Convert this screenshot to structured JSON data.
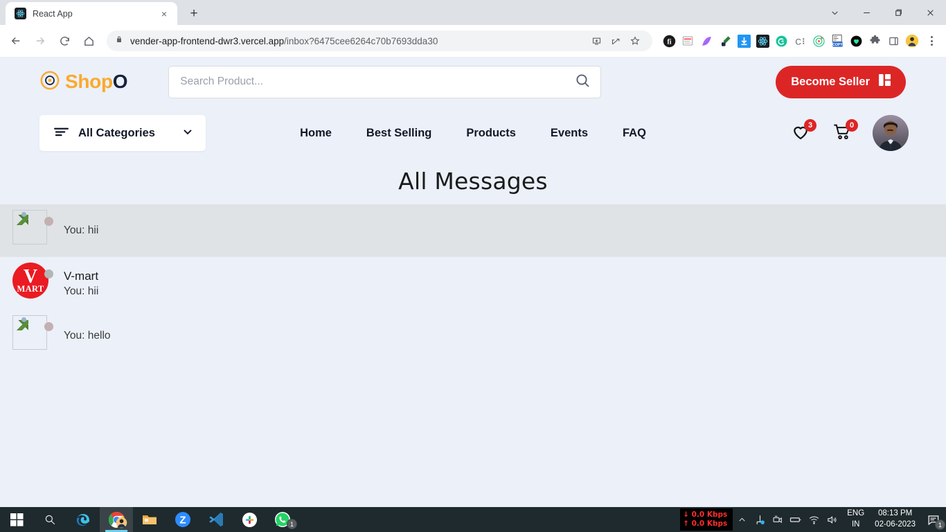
{
  "browser": {
    "tab": {
      "title": "React App",
      "favicon": "react-icon",
      "close_label": "×"
    },
    "new_tab_label": "+",
    "window_controls": {
      "tab_search": "tab-search-icon",
      "minimize": "minimize-icon",
      "maximize": "maximize-icon",
      "close": "close-icon"
    },
    "url": "vender-app-frontend-dwr3.vercel.app",
    "url_path": "/inbox?6475cee6264c70b7693dda30",
    "extensions": [
      "install-icon",
      "share-icon",
      "bookmark-star-icon",
      "bitwarden-icon",
      "notes-icon",
      "gradient-icon",
      "eyedropper-icon",
      "download-icon",
      "react-devtools-icon",
      "grammarly-icon",
      "clickup-icon",
      "target-icon",
      "copy-icon",
      "heart-green-icon",
      "puzzle-icon",
      "sidepanel-icon",
      "profile-avatar-icon",
      "chrome-menu-icon"
    ]
  },
  "shop": {
    "logo": {
      "shop_text": "Shop",
      "o_text": "O",
      "icon": "target-logo-icon",
      "shop_color": "#fba92c",
      "o_color": "#17223b"
    },
    "search": {
      "placeholder": "Search Product...",
      "value": "",
      "icon": "search-icon"
    },
    "seller_button": {
      "label": "Become Seller",
      "icon": "dashboard-icon",
      "color": "#dc2626"
    },
    "categories": {
      "label": "All Categories",
      "icon": "filter-lines-icon",
      "chevron": "chevron-down-icon"
    },
    "nav_links": [
      "Home",
      "Best Selling",
      "Products",
      "Events",
      "FAQ"
    ],
    "actions": {
      "wishlist": {
        "icon": "heart-icon",
        "count": "3"
      },
      "cart": {
        "icon": "cart-icon",
        "count": "0"
      },
      "avatar": {
        "icon": "user-avatar"
      }
    }
  },
  "main": {
    "title": "All Messages",
    "conversations": [
      {
        "name": "",
        "preview": "You: hii",
        "avatar_type": "broken-image",
        "status": "away",
        "selected": true
      },
      {
        "name": "V-mart",
        "preview": "You: hii",
        "avatar_type": "vmart",
        "vmart_v": "V",
        "vmart_mart": "MART",
        "status": "offline",
        "selected": false
      },
      {
        "name": "",
        "preview": "You: hello",
        "avatar_type": "broken-image",
        "status": "away",
        "selected": false
      }
    ]
  },
  "taskbar": {
    "items": [
      {
        "name": "start-button",
        "icon": "windows-icon"
      },
      {
        "name": "search-button",
        "icon": "search-icon"
      },
      {
        "name": "edge",
        "icon": "edge-icon"
      },
      {
        "name": "chrome",
        "icon": "chrome-icon",
        "active": true
      },
      {
        "name": "file-explorer",
        "icon": "folder-icon"
      },
      {
        "name": "zoom",
        "icon": "zoom-icon"
      },
      {
        "name": "vscode",
        "icon": "vscode-icon"
      },
      {
        "name": "slack",
        "icon": "slack-icon"
      },
      {
        "name": "whatsapp",
        "icon": "whatsapp-icon",
        "badge": "1"
      }
    ],
    "network": {
      "download": "0.0 Kbps",
      "upload": "0.0 Kbps",
      "down_arrow": "↓",
      "up_arrow": "↑"
    },
    "tray_icons": [
      "chevron-up-icon",
      "network-share-icon",
      "camera-icon",
      "battery-icon",
      "wifi-icon",
      "volume-icon"
    ],
    "language": {
      "line1": "ENG",
      "line2": "IN"
    },
    "clock": {
      "time": "08:13 PM",
      "date": "02-06-2023"
    },
    "notifications": {
      "icon": "notification-icon",
      "count": "1"
    }
  }
}
